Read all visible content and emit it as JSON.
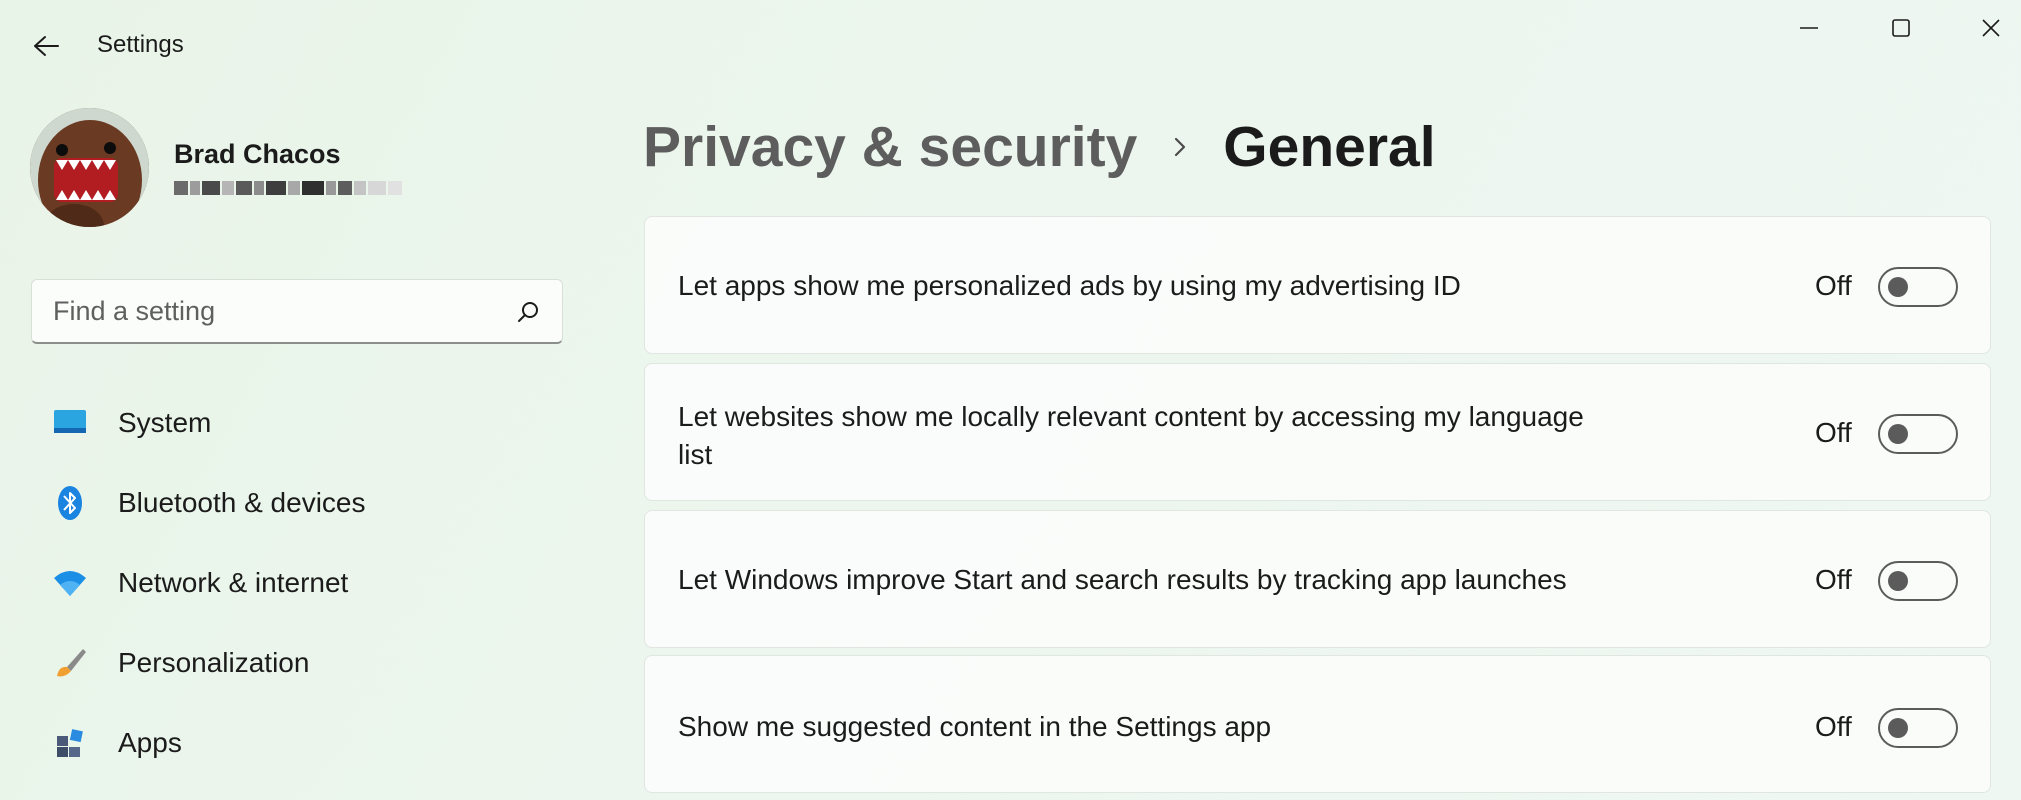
{
  "window": {
    "app_title": "Settings",
    "controls": [
      "minimize-icon",
      "maximize-icon",
      "close-icon"
    ]
  },
  "profile": {
    "name": "Brad Chacos",
    "email_redacted": true
  },
  "search": {
    "placeholder": "Find a setting",
    "icon": "search-icon"
  },
  "sidebar": {
    "items": [
      {
        "label": "System",
        "icon": "monitor-icon"
      },
      {
        "label": "Bluetooth & devices",
        "icon": "bluetooth-icon"
      },
      {
        "label": "Network & internet",
        "icon": "wifi-icon"
      },
      {
        "label": "Personalization",
        "icon": "brush-icon"
      },
      {
        "label": "Apps",
        "icon": "apps-icon"
      }
    ]
  },
  "breadcrumb": {
    "parent": "Privacy & security",
    "separator_icon": "chevron-right-icon",
    "current": "General"
  },
  "settings": [
    {
      "label": "Let apps show me personalized ads by using my advertising ID",
      "state": "Off",
      "on": false
    },
    {
      "label": "Let websites show me locally relevant content by accessing my language list",
      "state": "Off",
      "on": false
    },
    {
      "label": "Let Windows improve Start and search results by tracking app launches",
      "state": "Off",
      "on": false
    },
    {
      "label": "Show me suggested content in the Settings app",
      "state": "Off",
      "on": false
    }
  ],
  "colors": {
    "background": "#eaf5eb",
    "card": "#fbfdfc",
    "accent_blue": "#0a78d7",
    "toggle_off": "#5b5b5b"
  }
}
